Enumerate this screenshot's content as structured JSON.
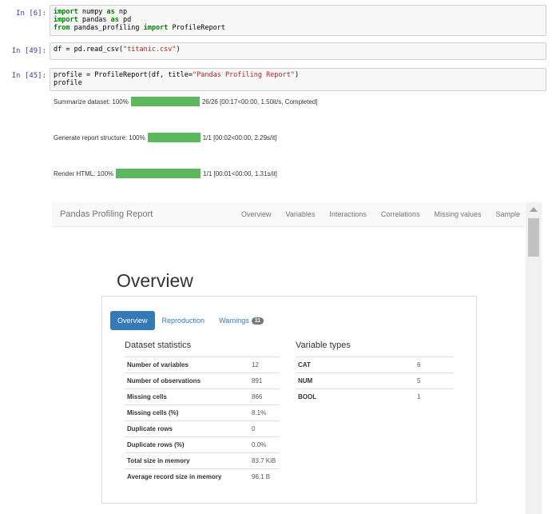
{
  "cells": [
    {
      "prompt": "In [6]:"
    },
    {
      "prompt": "In [49]:"
    },
    {
      "prompt": "In [45]:"
    }
  ],
  "code": {
    "c1": {
      "kw_import": "import",
      "kw_as": "as",
      "kw_from": "from",
      "l1_numpy": " numpy ",
      "l1_np": " np",
      "l2_pandas": " pandas ",
      "l2_pd": " pd",
      "l3_mod": " pandas_profiling ",
      "l3_cls": " ProfileReport"
    },
    "c2": {
      "pre": "df = pd.read_csv(",
      "str": "\"titanic.csv\"",
      "post": ")"
    },
    "c3": {
      "pre": "profile = ProfileReport(df, title=",
      "str": "\"Pandas Profiling Report\"",
      "post": ")",
      "line2": "profile"
    }
  },
  "progress": [
    {
      "label": "Summarize dataset: 100%",
      "percent": 100,
      "info": "26/26 [00:17<00:00,  1.50it/s, Completed]"
    },
    {
      "label": "Generate report structure: 100%",
      "percent": 100,
      "info": "1/1 [00:02<00:00,  2.29s/it]"
    },
    {
      "label": "Render HTML: 100%",
      "percent": 100,
      "info": "1/1 [00:01<00:00,  1.31s/it]"
    }
  ],
  "report": {
    "brand": "Pandas Profiling Report",
    "nav": [
      "Overview",
      "Variables",
      "Interactions",
      "Correlations",
      "Missing values",
      "Sample"
    ],
    "title": "Overview",
    "tabs": {
      "overview": "Overview",
      "reproduction": "Reproduction",
      "warnings": "Warnings",
      "warnings_count": "11"
    },
    "stats_title": "Dataset statistics",
    "stats": [
      {
        "k": "Number of variables",
        "v": "12"
      },
      {
        "k": "Number of observations",
        "v": "891"
      },
      {
        "k": "Missing cells",
        "v": "866"
      },
      {
        "k": "Missing cells (%)",
        "v": "8.1%"
      },
      {
        "k": "Duplicate rows",
        "v": "0"
      },
      {
        "k": "Duplicate rows (%)",
        "v": "0.0%"
      },
      {
        "k": "Total size in memory",
        "v": "83.7 KiB"
      },
      {
        "k": "Average record size in memory",
        "v": "96.1 B"
      }
    ],
    "types_title": "Variable types",
    "types": [
      {
        "k": "CAT",
        "v": "6"
      },
      {
        "k": "NUM",
        "v": "5"
      },
      {
        "k": "BOOL",
        "v": "1"
      }
    ]
  },
  "colors": {
    "progress": "#5cb85c",
    "active_tab": "#337ab7",
    "prompt": "#303f9f"
  }
}
